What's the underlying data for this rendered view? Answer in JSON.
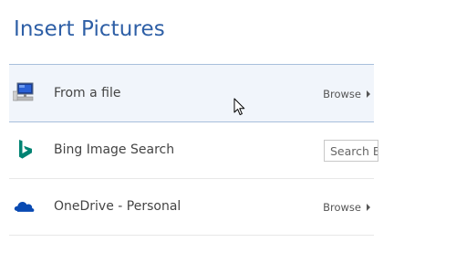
{
  "dialog": {
    "title": "Insert Pictures"
  },
  "sources": [
    {
      "label": "From a file",
      "icon": "computer-monitor-icon",
      "action_label": "Browse",
      "selected": true
    },
    {
      "label": "Bing Image Search",
      "icon": "bing-logo-icon",
      "search_placeholder": "Search Bing"
    },
    {
      "label": "OneDrive - Personal",
      "icon": "onedrive-cloud-icon",
      "action_label": "Browse"
    }
  ],
  "colors": {
    "title": "#2e5fa6",
    "selected_row_bg": "#f1f5fb",
    "selected_row_border": "#a8bfdc",
    "bing_accent": "#008373",
    "onedrive_blue": "#094ab2"
  }
}
